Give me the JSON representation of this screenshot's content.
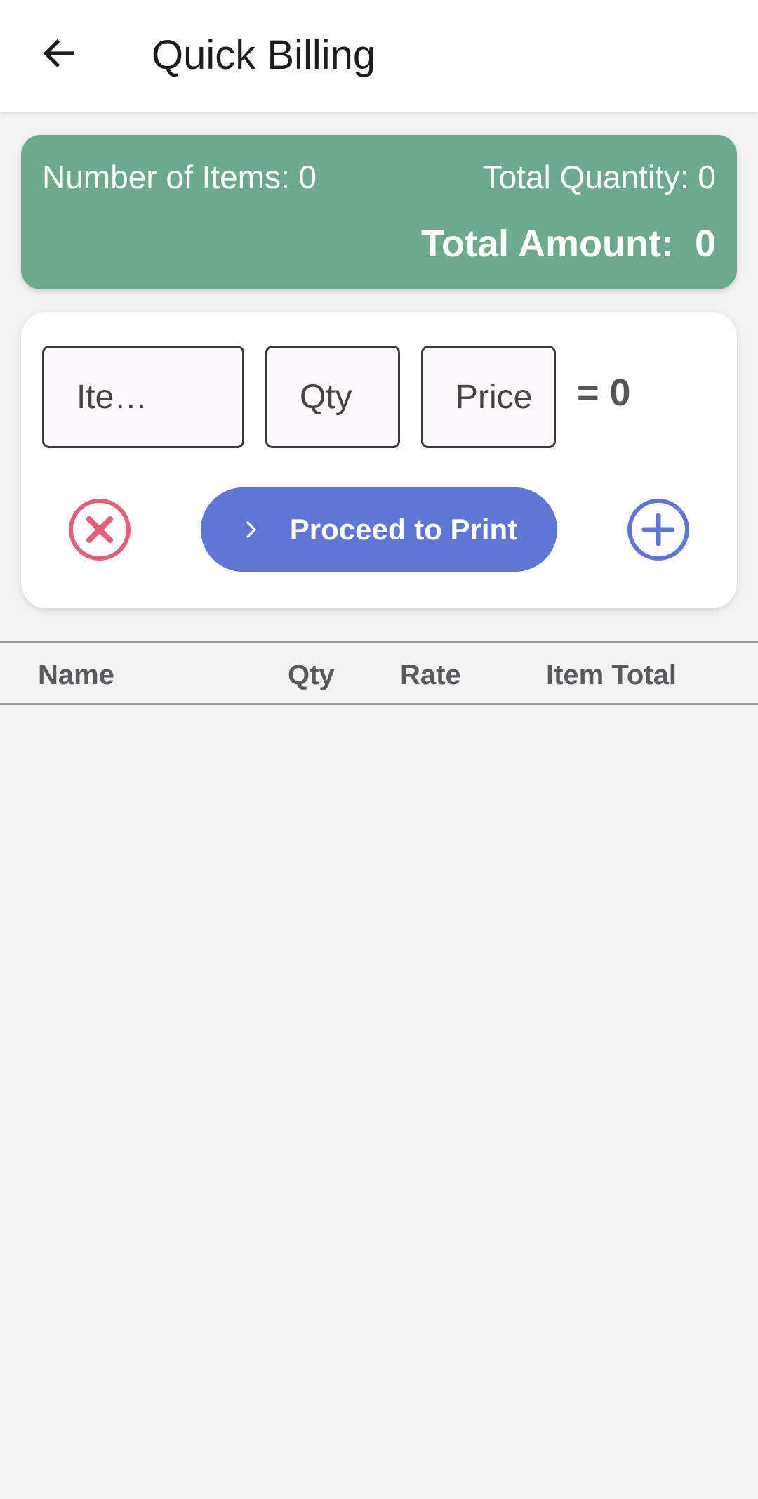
{
  "header": {
    "title": "Quick Billing",
    "back_icon": "arrow-left-icon"
  },
  "summary": {
    "number_of_items": "Number of Items: 0",
    "total_quantity": "Total Quantity: 0",
    "total_amount": "Total Amount:  0",
    "background_color": "#6daa8b"
  },
  "entry": {
    "item_placeholder": "Ite…",
    "qty_placeholder": "Qty",
    "price_placeholder": "Price",
    "line_total": "= 0",
    "clear_icon": "close-circle-icon",
    "add_icon": "plus-circle-icon",
    "proceed_label": "Proceed to Print",
    "proceed_icon": "chevron-right-icon",
    "accent_color": "#5f76d6",
    "danger_color": "#e0607a"
  },
  "table": {
    "columns": [
      "Name",
      "Qty",
      "Rate",
      "Item Total"
    ],
    "rows": []
  }
}
